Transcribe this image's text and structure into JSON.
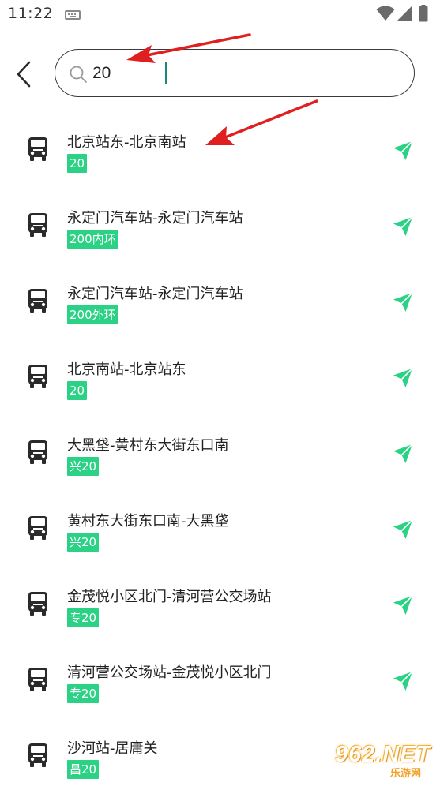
{
  "status_bar": {
    "time": "11:22",
    "icons": [
      "keyboard-icon",
      "wifi-icon",
      "signal-icon",
      "battery-icon"
    ]
  },
  "header": {
    "back_icon": "chevron-left-icon",
    "search": {
      "icon": "search-icon",
      "value": "20",
      "placeholder": ""
    }
  },
  "routes": [
    {
      "name": "北京站东-北京南站",
      "badge": "20"
    },
    {
      "name": "永定门汽车站-永定门汽车站",
      "badge": "200内环"
    },
    {
      "name": "永定门汽车站-永定门汽车站",
      "badge": "200外环"
    },
    {
      "name": "北京南站-北京站东",
      "badge": "20"
    },
    {
      "name": "大黑垡-黄村东大街东口南",
      "badge": "兴20"
    },
    {
      "name": "黄村东大街东口南-大黑垡",
      "badge": "兴20"
    },
    {
      "name": "金茂悦小区北门-清河营公交场站",
      "badge": "专20"
    },
    {
      "name": "清河营公交场站-金茂悦小区北门",
      "badge": "专20"
    },
    {
      "name": "沙河站-居庸关",
      "badge": "昌20"
    }
  ],
  "colors": {
    "accent": "#2bd184",
    "badge_text": "#ffffff",
    "annotation": "#e02020",
    "caret": "#1a8a78"
  },
  "watermark": {
    "main": "962.NET",
    "sub": "乐游网"
  }
}
